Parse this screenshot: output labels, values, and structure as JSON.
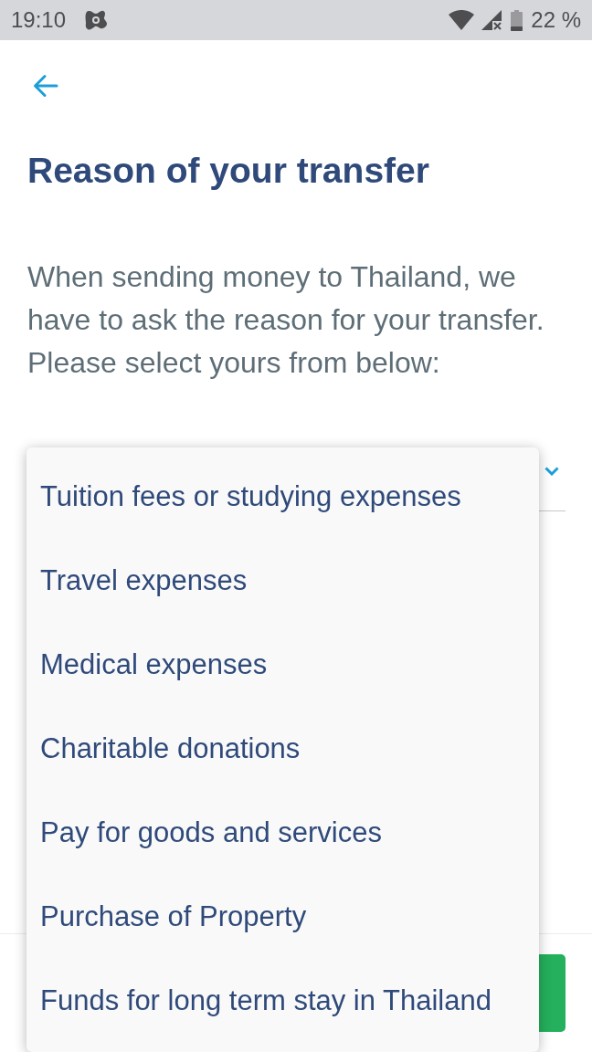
{
  "status_bar": {
    "time": "19:10",
    "battery_text": "22 %"
  },
  "title": "Reason of your transfer",
  "intro": "When sending money to Thailand, we have to ask the reason for your transfer. Please select yours from below:",
  "reason_select": {
    "expanded": true,
    "options": [
      {
        "label": "Tuition fees or studying expenses",
        "selected": false
      },
      {
        "label": "Travel expenses",
        "selected": false
      },
      {
        "label": "Medical expenses",
        "selected": false
      },
      {
        "label": "Charitable donations",
        "selected": false
      },
      {
        "label": "Pay for goods and services",
        "selected": false
      },
      {
        "label": "Purchase of Property",
        "selected": false
      },
      {
        "label": "Funds for long term stay in Thailand",
        "selected": false
      }
    ]
  }
}
